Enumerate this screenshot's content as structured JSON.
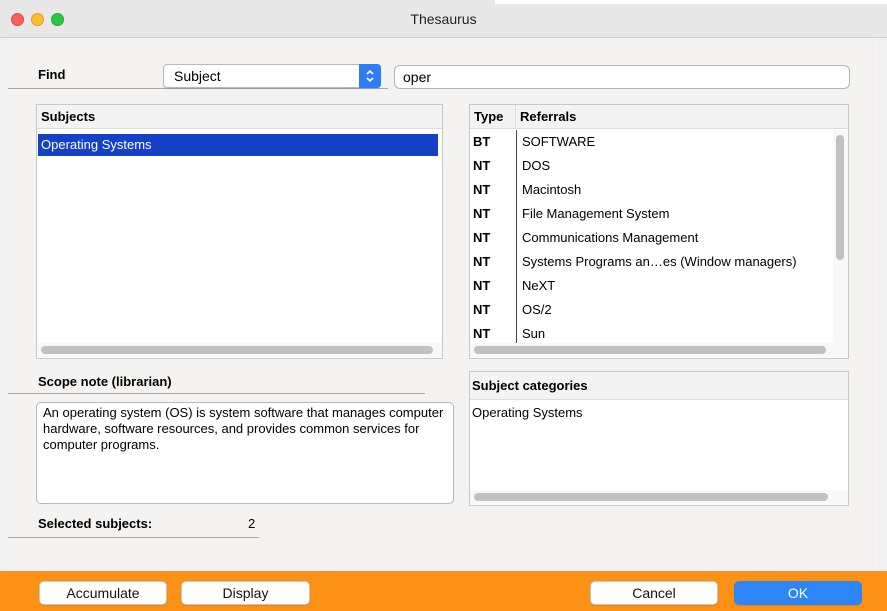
{
  "window": {
    "title": "Thesaurus",
    "traffic_lights": [
      "close",
      "minimize",
      "zoom"
    ]
  },
  "find": {
    "label": "Find",
    "select_value": "Subject",
    "input_value": "oper"
  },
  "subjects": {
    "header": "Subjects",
    "items": [
      "Operating Systems"
    ],
    "selected_index": 0
  },
  "referrals": {
    "type_header": "Type",
    "referrals_header": "Referrals",
    "rows": [
      {
        "type": "BT",
        "text": "SOFTWARE"
      },
      {
        "type": "NT",
        "text": "DOS"
      },
      {
        "type": "NT",
        "text": "Macintosh"
      },
      {
        "type": "NT",
        "text": "File Management System"
      },
      {
        "type": "NT",
        "text": "Communications Management"
      },
      {
        "type": "NT",
        "text": "Systems Programs an…es (Window managers)"
      },
      {
        "type": "NT",
        "text": "NeXT"
      },
      {
        "type": "NT",
        "text": "OS/2"
      },
      {
        "type": "NT",
        "text": "Sun"
      }
    ]
  },
  "scope_note": {
    "label": "Scope note (librarian)",
    "text": "An operating system (OS) is system software that manages computer hardware, software resources, and provides common services for computer programs."
  },
  "subject_categories": {
    "header": "Subject categories",
    "items": [
      "Operating Systems"
    ]
  },
  "selected_subjects": {
    "label": "Selected subjects:",
    "count": "2"
  },
  "buttons": {
    "accumulate": "Accumulate",
    "display": "Display",
    "cancel": "Cancel",
    "ok": "OK"
  },
  "colors": {
    "bottom_bar": "#fb9216",
    "selection": "#1541c8",
    "primary_button": "#2d86f7",
    "select_stepper": "#2f7df6"
  }
}
